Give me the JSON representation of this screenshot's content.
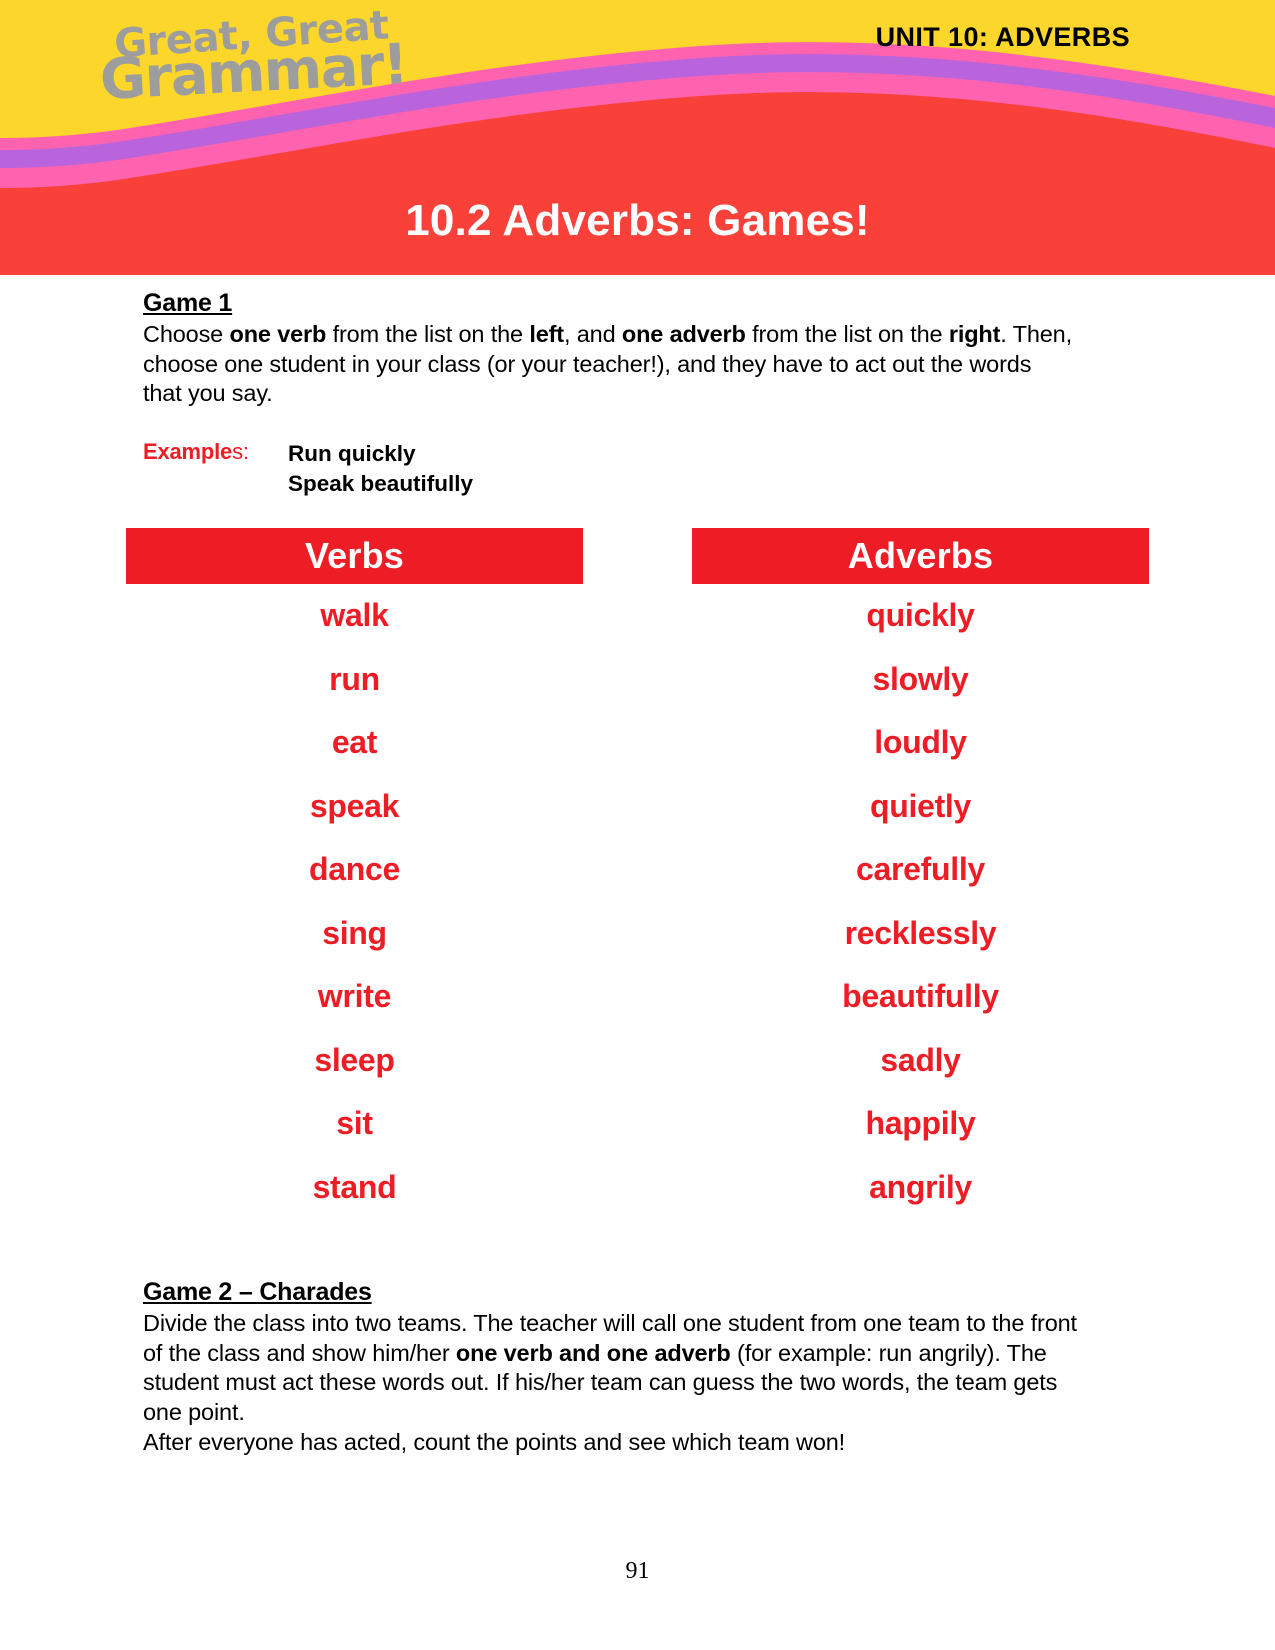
{
  "header": {
    "logo_line1": "Great, Great",
    "logo_line2": "Grammar!",
    "unit_label": "UNIT 10: ADVERBS",
    "page_title": "10.2 Adverbs:  Games!",
    "colors": {
      "yellow": "#FCD62B",
      "pink": "#FF63B0",
      "purple": "#B963DC",
      "red": "#F9413A",
      "logo_gray": "#9D9D9D"
    }
  },
  "game1": {
    "heading": "Game 1",
    "instructions_parts": [
      {
        "text": "Choose ",
        "bold": false
      },
      {
        "text": "one verb",
        "bold": true
      },
      {
        "text": " from the list on the ",
        "bold": false
      },
      {
        "text": "left",
        "bold": true
      },
      {
        "text": ", and ",
        "bold": false
      },
      {
        "text": "one adverb",
        "bold": true
      },
      {
        "text": " from the list on the ",
        "bold": false
      },
      {
        "text": "right",
        "bold": true
      },
      {
        "text": ". Then, choose one student in your class (or your teacher!), and they have to act out the words that you say.",
        "bold": false
      }
    ],
    "examples_label_bold": "Example",
    "examples_label_thin": "s:",
    "examples": [
      "Run quickly",
      "Speak beautifully"
    ]
  },
  "table": {
    "accent_color": "#EE1C25",
    "columns": [
      {
        "header": "Verbs",
        "words": [
          "walk",
          "run",
          "eat",
          "speak",
          "dance",
          "sing",
          "write",
          "sleep",
          "sit",
          "stand"
        ]
      },
      {
        "header": "Adverbs",
        "words": [
          "quickly",
          "slowly",
          "loudly",
          "quietly",
          "carefully",
          "recklessly",
          "beautifully",
          "sadly",
          "happily",
          "angrily"
        ]
      }
    ]
  },
  "game2": {
    "heading": "Game 2 – Charades",
    "instructions_parts": [
      {
        "text": "Divide the class into two teams. The teacher will call one student from one team to the front of the class and show him/her ",
        "bold": false
      },
      {
        "text": "one verb and one adverb",
        "bold": true
      },
      {
        "text": " (for example: run angrily). The student must act these words out. If his/her team can guess the two words, the team gets one point.",
        "bold": false
      }
    ],
    "closing": "After everyone has acted, count the points and see which team won!"
  },
  "footer": {
    "page_number": "91"
  }
}
